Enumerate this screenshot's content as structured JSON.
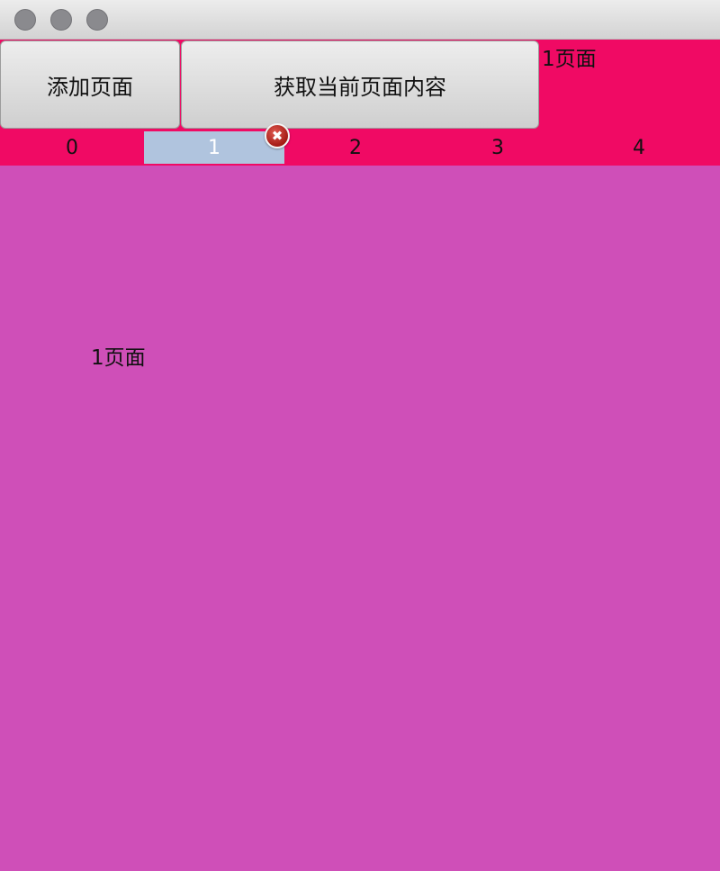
{
  "window": {
    "controls": [
      "close-icon",
      "minimize-icon",
      "zoom-icon"
    ]
  },
  "toolbar": {
    "add_page_label": "添加页面",
    "get_content_label": "获取当前页面内容",
    "current_page_label": "1页面"
  },
  "tabs": {
    "items": [
      {
        "label": "0"
      },
      {
        "label": "1"
      },
      {
        "label": "2"
      },
      {
        "label": "3"
      },
      {
        "label": "4"
      }
    ],
    "active_index": 1,
    "close_glyph": "✖"
  },
  "content": {
    "text": "1页面"
  },
  "colors": {
    "toolbar_bg": "#f00a64",
    "content_bg": "#cf4fb8",
    "active_tab_bg": "#b0c4de"
  }
}
